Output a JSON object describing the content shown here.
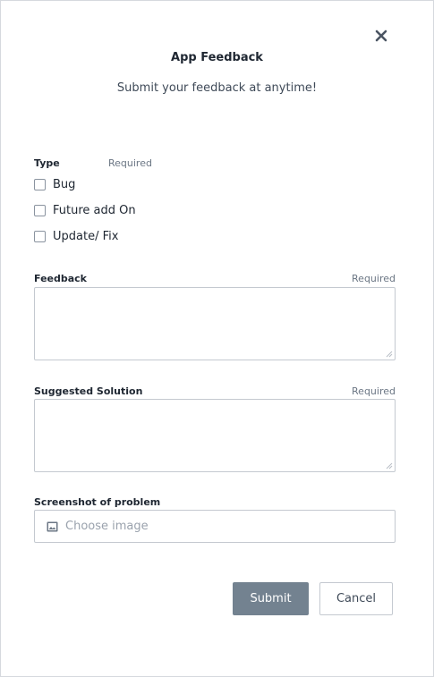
{
  "dialog": {
    "title": "App Feedback",
    "subtitle": "Submit your feedback at anytime!",
    "close_icon": "close-icon"
  },
  "type_field": {
    "label": "Type",
    "required": "Required",
    "options": [
      {
        "label": "Bug",
        "checked": false
      },
      {
        "label": "Future add On",
        "checked": false
      },
      {
        "label": "Update/ Fix",
        "checked": false
      }
    ]
  },
  "feedback_field": {
    "label": "Feedback",
    "required": "Required",
    "value": ""
  },
  "solution_field": {
    "label": "Suggested Solution",
    "required": "Required",
    "value": ""
  },
  "screenshot_field": {
    "label": "Screenshot of problem",
    "placeholder": "Choose image",
    "icon": "image-icon"
  },
  "actions": {
    "submit_label": "Submit",
    "cancel_label": "Cancel"
  },
  "colors": {
    "submit_bg": "#738290",
    "border": "#c4c9d0",
    "text": "#1e2631",
    "muted": "#6b7684"
  }
}
